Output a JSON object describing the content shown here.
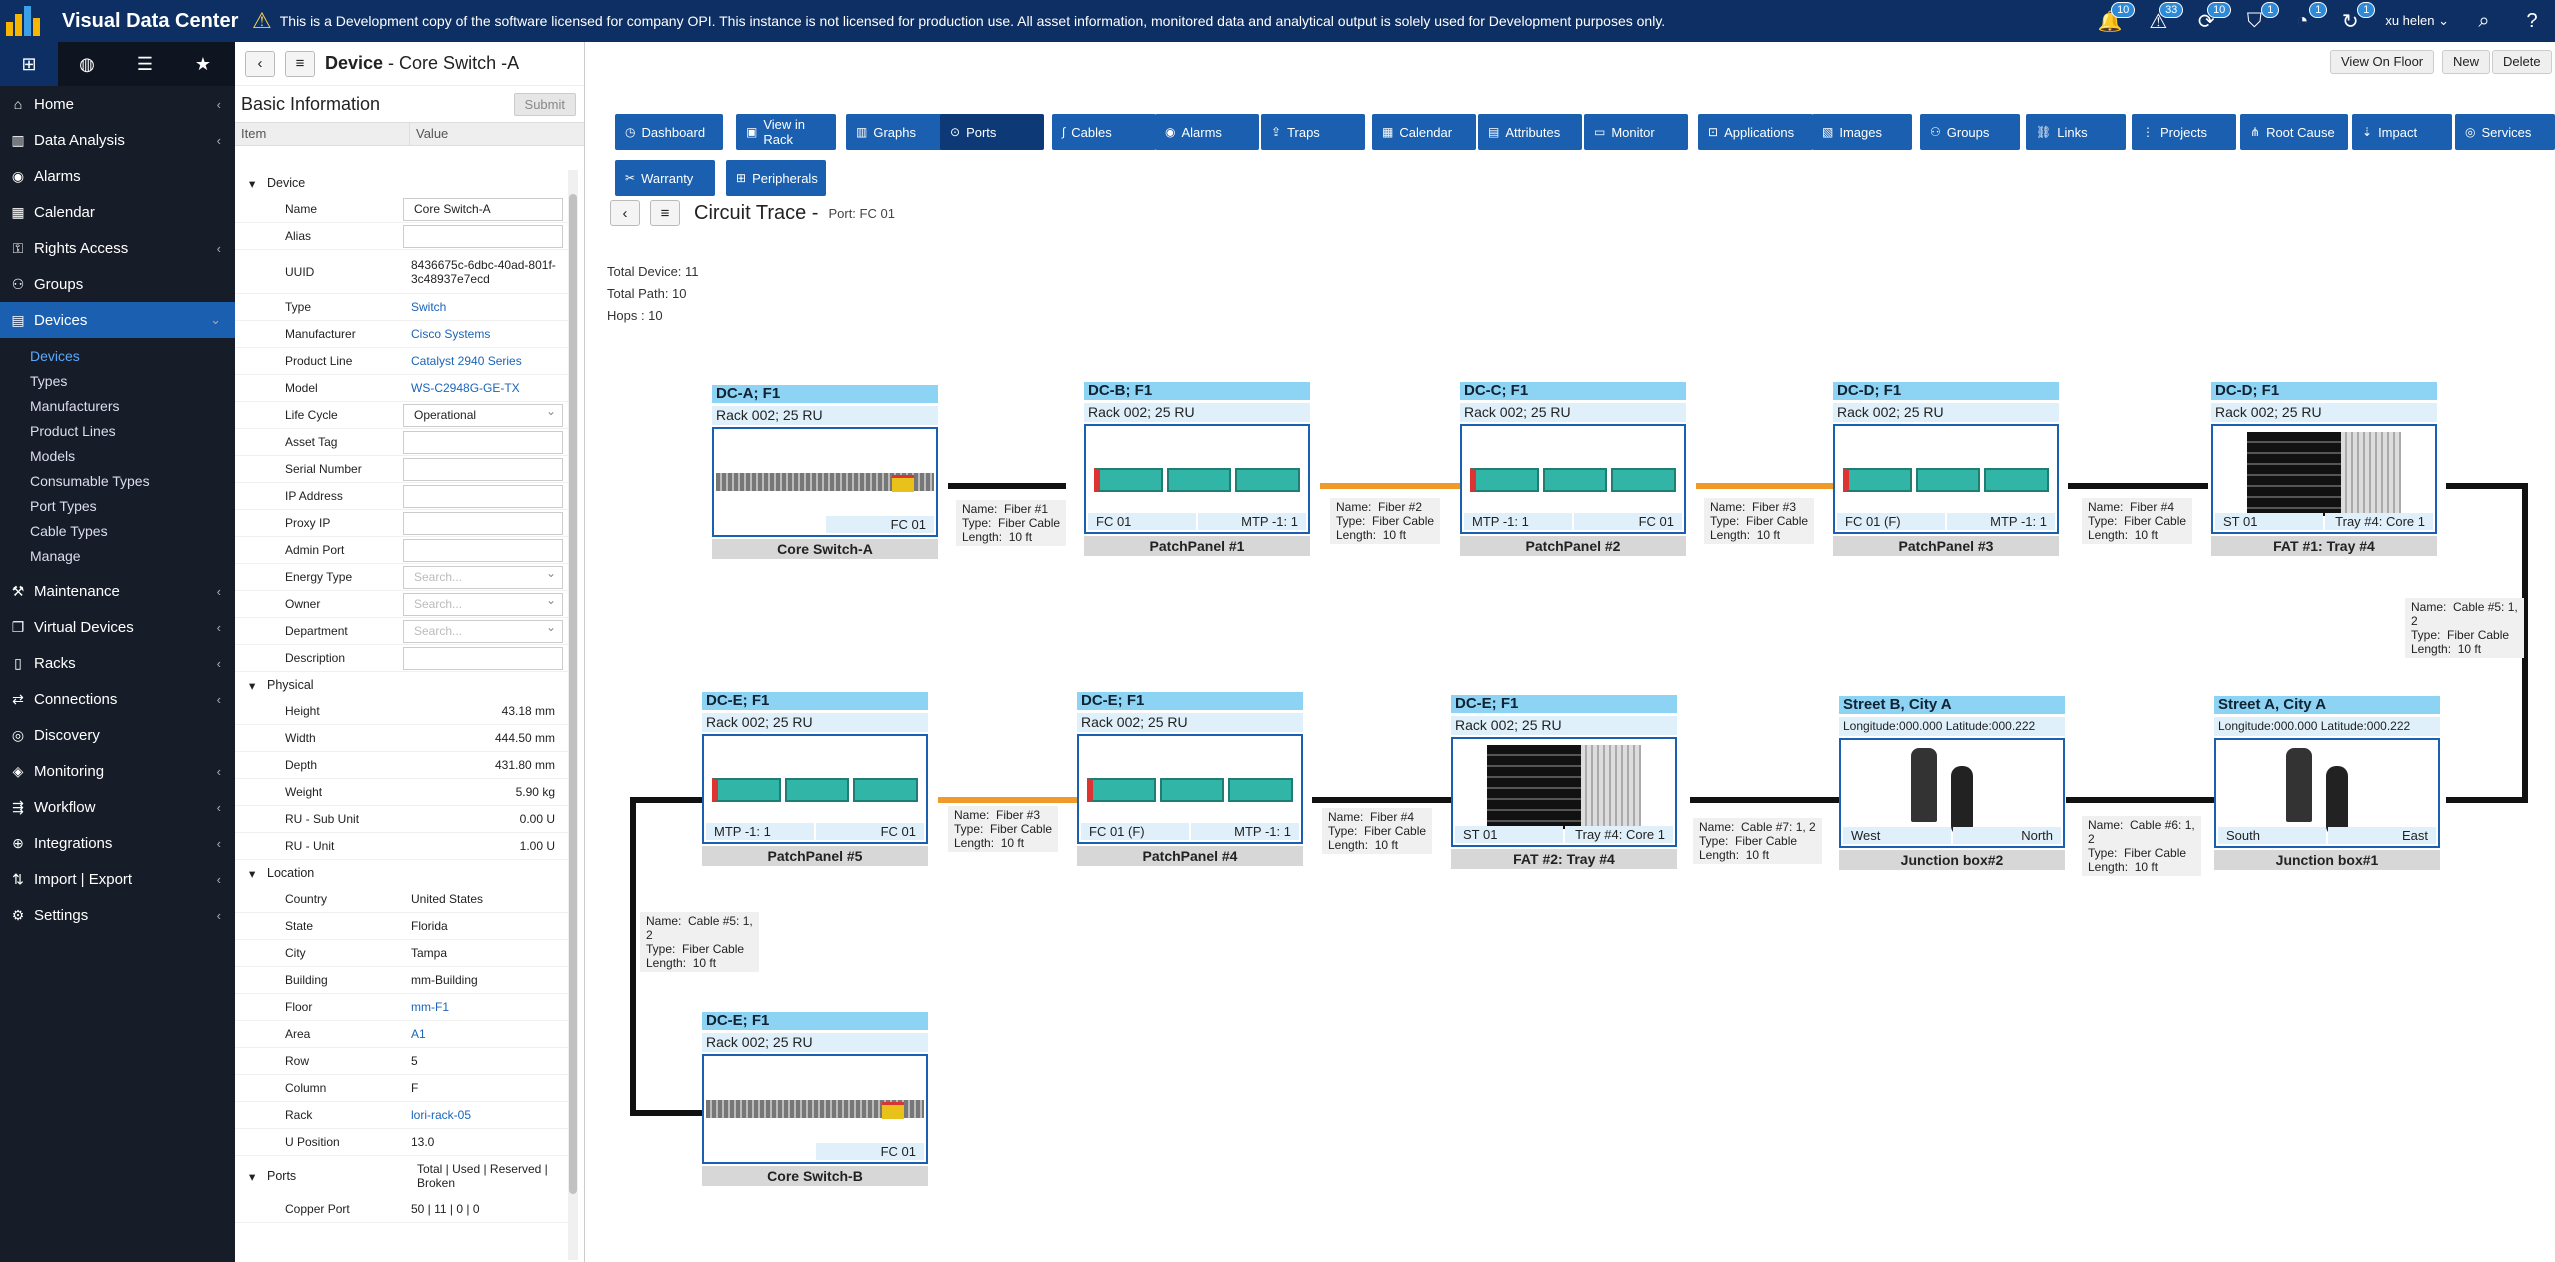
{
  "app": {
    "name": "Visual Data Center",
    "banner": "This is a Development copy of the software licensed for company OPI. This instance is not licensed for production use. All asset information, monitored data and analytical output is solely used for Development purposes only.",
    "user": "xu helen",
    "badges": [
      "10",
      "33",
      "10",
      "1",
      "1",
      "1"
    ]
  },
  "nav": {
    "items": [
      {
        "label": "Home",
        "icon": "home-icon"
      },
      {
        "label": "Data Analysis",
        "icon": "chart-icon"
      },
      {
        "label": "Alarms",
        "icon": "alarm-icon"
      },
      {
        "label": "Calendar",
        "icon": "calendar-icon"
      },
      {
        "label": "Rights Access",
        "icon": "key-icon"
      },
      {
        "label": "Groups",
        "icon": "groups-icon"
      },
      {
        "label": "Devices",
        "icon": "device-icon"
      }
    ],
    "sub": [
      "Devices",
      "Types",
      "Manufacturers",
      "Product Lines",
      "Models",
      "Consumable Types",
      "Port Types",
      "Cable Types",
      "Manage"
    ],
    "items2": [
      {
        "label": "Maintenance"
      },
      {
        "label": "Virtual Devices"
      },
      {
        "label": "Racks"
      },
      {
        "label": "Connections"
      },
      {
        "label": "Discovery"
      },
      {
        "label": "Monitoring"
      },
      {
        "label": "Workflow"
      },
      {
        "label": "Integrations"
      },
      {
        "label": "Import | Export"
      },
      {
        "label": "Settings"
      }
    ]
  },
  "detail": {
    "title_prefix": "Device",
    "title": " - Core Switch -A",
    "section": "Basic Information",
    "submit": "Submit",
    "col_item": "Item",
    "col_value": "Value",
    "sec_device": "Device",
    "sec_physical": "Physical",
    "sec_location": "Location",
    "sec_ports": "Ports",
    "device": [
      {
        "k": "Name",
        "v": "Core Switch-A"
      },
      {
        "k": "Alias",
        "v": ""
      },
      {
        "k": "UUID",
        "v": "8436675c-6dbc-40ad-801f-3c48937e7ecd"
      },
      {
        "k": "Type",
        "v": "Switch"
      },
      {
        "k": "Manufacturer",
        "v": "Cisco Systems"
      },
      {
        "k": "Product Line",
        "v": "Catalyst 2940 Series"
      },
      {
        "k": "Model",
        "v": "WS-C2948G-GE-TX"
      },
      {
        "k": "Life Cycle",
        "v": "Operational"
      },
      {
        "k": "Asset Tag",
        "v": ""
      },
      {
        "k": "Serial Number",
        "v": ""
      },
      {
        "k": "IP Address",
        "v": ""
      },
      {
        "k": "Proxy IP",
        "v": ""
      },
      {
        "k": "Admin Port",
        "v": ""
      },
      {
        "k": "Energy Type",
        "v": "Search..."
      },
      {
        "k": "Owner",
        "v": "Search..."
      },
      {
        "k": "Department",
        "v": "Search..."
      },
      {
        "k": "Description",
        "v": ""
      }
    ],
    "physical": [
      {
        "k": "Height",
        "v": "43.18 mm"
      },
      {
        "k": "Width",
        "v": "444.50 mm"
      },
      {
        "k": "Depth",
        "v": "431.80 mm"
      },
      {
        "k": "Weight",
        "v": "5.90 kg"
      },
      {
        "k": "RU - Sub Unit",
        "v": "0.00 U"
      },
      {
        "k": "RU - Unit",
        "v": "1.00 U"
      }
    ],
    "location": [
      {
        "k": "Country",
        "v": "United States"
      },
      {
        "k": "State",
        "v": "Florida"
      },
      {
        "k": "City",
        "v": "Tampa"
      },
      {
        "k": "Building",
        "v": "mm-Building"
      },
      {
        "k": "Floor",
        "v": "mm-F1"
      },
      {
        "k": "Area",
        "v": "A1"
      },
      {
        "k": "Row",
        "v": "5"
      },
      {
        "k": "Column",
        "v": "F"
      },
      {
        "k": "Rack",
        "v": "lori-rack-05"
      },
      {
        "k": "U Position",
        "v": "13.0"
      }
    ],
    "ports_header": "Total | Used | Reserved | Broken",
    "copper": {
      "k": "Copper Port",
      "v": "50 | 11 | 0 | 0"
    }
  },
  "main": {
    "view_on_floor": "View On Floor",
    "new": "New",
    "delete": "Delete",
    "tabs": [
      "Dashboard",
      "View in Rack",
      "Graphs",
      "Ports",
      "Cables",
      "Alarms",
      "Traps",
      "Calendar",
      "Attributes",
      "Monitor",
      "Applications",
      "Images",
      "Groups",
      "Links",
      "Projects",
      "Root Cause",
      "Impact",
      "Services",
      "Warranty",
      "Peripherals"
    ],
    "ct_title": "Circuit Trace -",
    "ct_port": "Port: FC 01",
    "total_device": "Total Device:  11",
    "total_path": "Total Path:  10",
    "hops": "Hops :  10"
  },
  "devices": [
    {
      "loc": "DC-A;   F1",
      "rack": "Rack 002;   25 RU",
      "name": "Core Switch-A",
      "kind": "switch",
      "l": "",
      "r": "FC 01"
    },
    {
      "loc": "DC-B;   F1",
      "rack": "Rack 002;   25 RU",
      "name": "PatchPanel #1",
      "kind": "pp",
      "l": "FC 01",
      "r": "MTP -1: 1"
    },
    {
      "loc": "DC-C;   F1",
      "rack": "Rack 002;   25 RU",
      "name": "PatchPanel #2",
      "kind": "pp",
      "l": "MTP -1: 1",
      "r": "FC 01"
    },
    {
      "loc": "DC-D;   F1",
      "rack": "Rack 002;   25 RU",
      "name": "PatchPanel #3",
      "kind": "pp",
      "l": "FC 01 (F)",
      "r": "MTP -1: 1"
    },
    {
      "loc": "DC-D;   F1",
      "rack": "Rack 002;   25 RU",
      "name": "FAT #1: Tray #4",
      "kind": "fat",
      "l": "ST 01",
      "r": "Tray #4: Core 1"
    },
    {
      "loc": "DC-E;   F1",
      "rack": "Rack 002;   25 RU",
      "name": "PatchPanel #5",
      "kind": "pp",
      "l": "MTP -1: 1",
      "r": "FC 01"
    },
    {
      "loc": "DC-E;   F1",
      "rack": "Rack 002;   25 RU",
      "name": "PatchPanel #4",
      "kind": "pp",
      "l": "FC 01 (F)",
      "r": "MTP -1: 1"
    },
    {
      "loc": "DC-E;   F1",
      "rack": "Rack 002;   25 RU",
      "name": "FAT #2: Tray #4",
      "kind": "fat",
      "l": "ST 01",
      "r": "Tray #4:  Core 1"
    },
    {
      "loc": "Street B, City A",
      "rack": "Longitude:000.000   Latitude:000.222",
      "name": "Junction box#2",
      "kind": "jb",
      "l": "West",
      "r": "North"
    },
    {
      "loc": "Street A, City A",
      "rack": "Longitude:000.000   Latitude:000.222",
      "name": "Junction box#1",
      "kind": "jb",
      "l": "South",
      "r": "East"
    },
    {
      "loc": "DC-E;   F1",
      "rack": "Rack 002;   25 RU",
      "name": "Core Switch-B",
      "kind": "switch",
      "l": "",
      "r": "FC 01"
    }
  ],
  "connections": [
    "Name:  Fiber #1\nType:  Fiber Cable\nLength:  10 ft",
    "Name:  Fiber #2\nType:  Fiber Cable\nLength:  10 ft",
    "Name:  Fiber #3\nType:  Fiber Cable\nLength:  10 ft",
    "Name:  Fiber #4\nType:  Fiber Cable\nLength:  10 ft",
    "Name:  Cable #5: 1,\n2\nType:  Fiber Cable\nLength:  10 ft",
    "Name:  Fiber #3\nType:  Fiber Cable\nLength:  10 ft",
    "Name:  Fiber #4\nType:  Fiber Cable\nLength:  10 ft",
    "Name:  Cable #7: 1, 2\nType:  Fiber Cable\nLength:  10 ft",
    "Name:  Cable #6: 1,\n2\nType:  Fiber Cable\nLength:  10 ft",
    "Name:  Cable #5: 1,\n2\nType:  Fiber Cable\nLength:  10 ft"
  ]
}
